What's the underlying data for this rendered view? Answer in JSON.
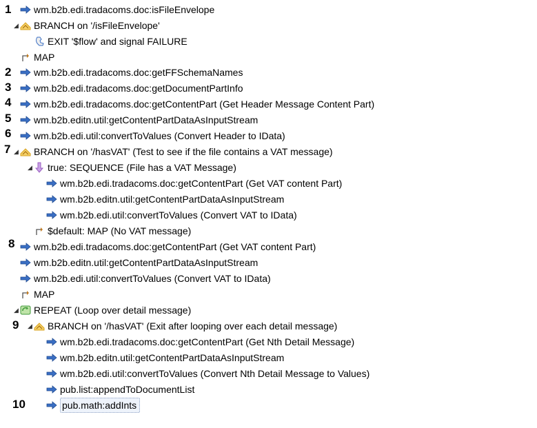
{
  "steps": [
    {
      "label": "wm.b2b.edi.tradacoms.doc:isFileEnvelope",
      "number": "1",
      "icon": "invoke"
    },
    {
      "label": "BRANCH on '/isFileEnvelope'",
      "icon": "branch",
      "toggle": "◢"
    },
    {
      "label": "EXIT '$flow' and signal FAILURE",
      "icon": "exit"
    },
    {
      "label": "MAP",
      "icon": "map"
    },
    {
      "label": "wm.b2b.edi.tradacoms.doc:getFFSchemaNames",
      "number": "2",
      "icon": "invoke"
    },
    {
      "label": "wm.b2b.edi.tradacoms.doc:getDocumentPartInfo",
      "number": "3",
      "icon": "invoke"
    },
    {
      "label": "wm.b2b.edi.tradacoms.doc:getContentPart (Get Header Message Content Part)",
      "number": "4",
      "icon": "invoke"
    },
    {
      "label": "wm.b2b.editn.util:getContentPartDataAsInputStream",
      "number": "5",
      "icon": "invoke"
    },
    {
      "label": "wm.b2b.edi.util:convertToValues (Convert Header to IData)",
      "number": "6",
      "icon": "invoke"
    },
    {
      "label": "BRANCH on '/hasVAT' (Test to see if the file contains a VAT message)",
      "number": "7",
      "icon": "branch",
      "toggle": "◢"
    },
    {
      "label": "true: SEQUENCE (File has a VAT Message)",
      "icon": "sequence",
      "toggle": "◢"
    },
    {
      "label": "wm.b2b.edi.tradacoms.doc:getContentPart (Get VAT content Part)",
      "icon": "invoke"
    },
    {
      "label": "wm.b2b.editn.util:getContentPartDataAsInputStream",
      "icon": "invoke"
    },
    {
      "label": "wm.b2b.edi.util:convertToValues (Convert VAT to IData)",
      "icon": "invoke"
    },
    {
      "label": "$default: MAP (No VAT message)",
      "icon": "map"
    },
    {
      "label": "wm.b2b.edi.tradacoms.doc:getContentPart (Get VAT content Part)",
      "number": "8",
      "icon": "invoke"
    },
    {
      "label": "wm.b2b.editn.util:getContentPartDataAsInputStream",
      "icon": "invoke"
    },
    {
      "label": "wm.b2b.edi.util:convertToValues (Convert VAT to IData)",
      "icon": "invoke"
    },
    {
      "label": "MAP",
      "icon": "map"
    },
    {
      "label": "REPEAT (Loop over detail message)",
      "icon": "repeat",
      "toggle": "◢"
    },
    {
      "label": "BRANCH on '/hasVAT' (Exit after looping over each detail message)",
      "number": "9",
      "icon": "branch",
      "toggle": "◢"
    },
    {
      "label": "wm.b2b.edi.tradacoms.doc:getContentPart (Get Nth Detail Message)",
      "icon": "invoke"
    },
    {
      "label": "wm.b2b.editn.util:getContentPartDataAsInputStream",
      "icon": "invoke"
    },
    {
      "label": "wm.b2b.edi.util:convertToValues (Convert Nth Detail Message to Values)",
      "icon": "invoke"
    },
    {
      "label": "pub.list:appendToDocumentList",
      "icon": "invoke"
    },
    {
      "label": "pub.math:addInts",
      "number": "10",
      "icon": "invoke",
      "selected": true
    }
  ],
  "colors": {
    "invoke": "#3a6fc4",
    "branch": "#d9a21b",
    "sequence": "#9b5fc0",
    "repeat": "#3f9a3a",
    "map": "#c07a1e"
  }
}
